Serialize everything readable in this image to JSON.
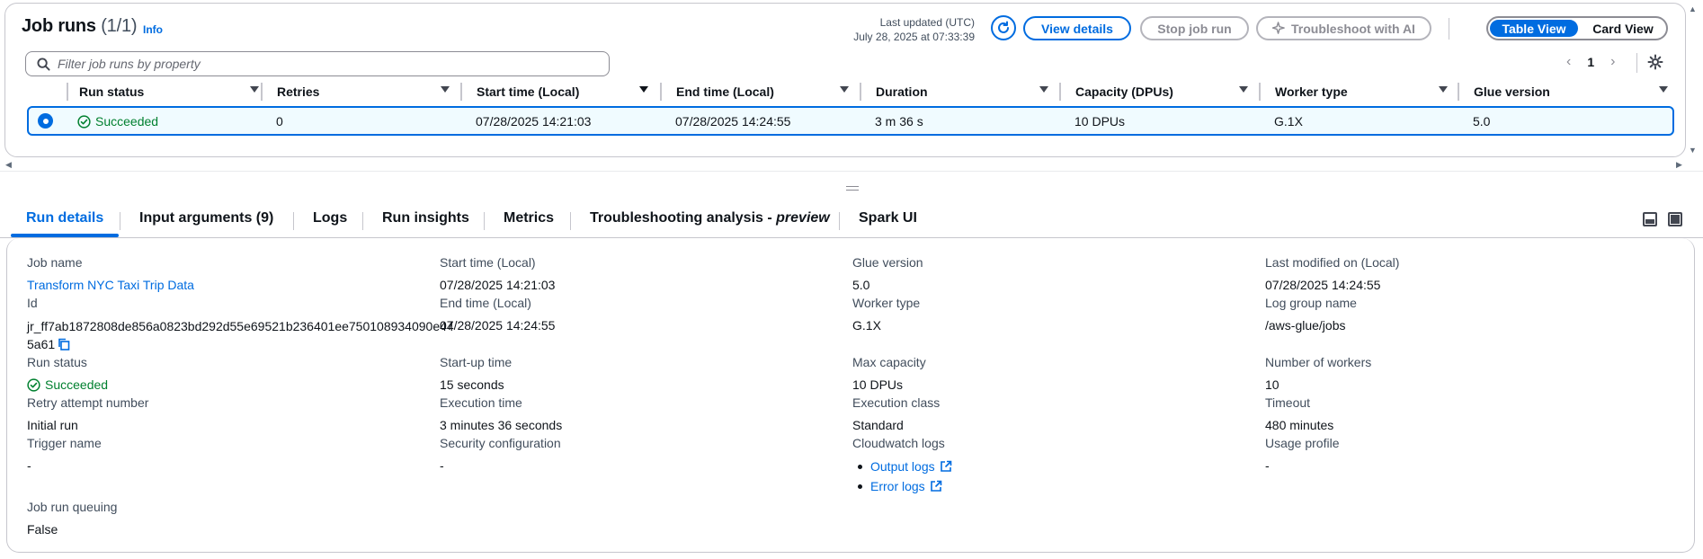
{
  "header": {
    "title": "Job runs",
    "count": "(1/1)",
    "info_link": "Info",
    "last_updated_label": "Last updated (UTC)",
    "last_updated_value": "July 28, 2025 at 07:33:39",
    "view_details": "View details",
    "stop_job_run": "Stop job run",
    "troubleshoot_ai": "Troubleshoot with AI",
    "view_toggle": {
      "table": "Table View",
      "card": "Card View",
      "selected": "Table View"
    }
  },
  "filter": {
    "placeholder": "Filter job runs by property"
  },
  "pagination": {
    "current_page": "1"
  },
  "table": {
    "columns": [
      "Run status",
      "Retries",
      "Start time (Local)",
      "End time (Local)",
      "Duration",
      "Capacity (DPUs)",
      "Worker type",
      "Glue version"
    ],
    "sorted_column": "Start time (Local)",
    "rows": [
      {
        "selected": true,
        "run_status": "Succeeded",
        "retries": "0",
        "start_time": "07/28/2025 14:21:03",
        "end_time": "07/28/2025 14:24:55",
        "duration": "3 m 36 s",
        "capacity": "10 DPUs",
        "worker_type": "G.1X",
        "glue_version": "5.0"
      }
    ]
  },
  "tabs": {
    "items": [
      "Run details",
      "Input arguments (9)",
      "Logs",
      "Run insights",
      "Metrics"
    ],
    "troubleshooting_prefix": "Troubleshooting analysis - ",
    "troubleshooting_suffix": "preview",
    "spark_ui": "Spark UI",
    "active": "Run details"
  },
  "details": {
    "job_name": {
      "label": "Job name",
      "value": "Transform NYC Taxi Trip Data"
    },
    "id": {
      "label": "Id",
      "value": "jr_ff7ab1872808de856a0823bd292d55e69521b236401ee750108934090e445a61"
    },
    "run_status": {
      "label": "Run status",
      "value": "Succeeded"
    },
    "retry_attempt": {
      "label": "Retry attempt number",
      "value": "Initial run"
    },
    "trigger_name": {
      "label": "Trigger name",
      "value": "-"
    },
    "job_run_queuing": {
      "label": "Job run queuing",
      "value": "False"
    },
    "start_time": {
      "label": "Start time (Local)",
      "value": "07/28/2025 14:21:03"
    },
    "end_time": {
      "label": "End time (Local)",
      "value": "07/28/2025 14:24:55"
    },
    "startup_time": {
      "label": "Start-up time",
      "value": "15 seconds"
    },
    "execution_time": {
      "label": "Execution time",
      "value": "3 minutes 36 seconds"
    },
    "security_config": {
      "label": "Security configuration",
      "value": "-"
    },
    "glue_version": {
      "label": "Glue version",
      "value": "5.0"
    },
    "worker_type": {
      "label": "Worker type",
      "value": "G.1X"
    },
    "max_capacity": {
      "label": "Max capacity",
      "value": "10 DPUs"
    },
    "execution_class": {
      "label": "Execution class",
      "value": "Standard"
    },
    "cloudwatch_logs": {
      "label": "Cloudwatch logs",
      "output": "Output logs",
      "error": "Error logs"
    },
    "last_modified": {
      "label": "Last modified on (Local)",
      "value": "07/28/2025 14:24:55"
    },
    "log_group": {
      "label": "Log group name",
      "value": "/aws-glue/jobs"
    },
    "num_workers": {
      "label": "Number of workers",
      "value": "10"
    },
    "timeout": {
      "label": "Timeout",
      "value": "480 minutes"
    },
    "usage_profile": {
      "label": "Usage profile",
      "value": "-"
    }
  },
  "colors": {
    "accent": "#006ce0",
    "success": "#00802f",
    "border": "#c6c6cd"
  }
}
